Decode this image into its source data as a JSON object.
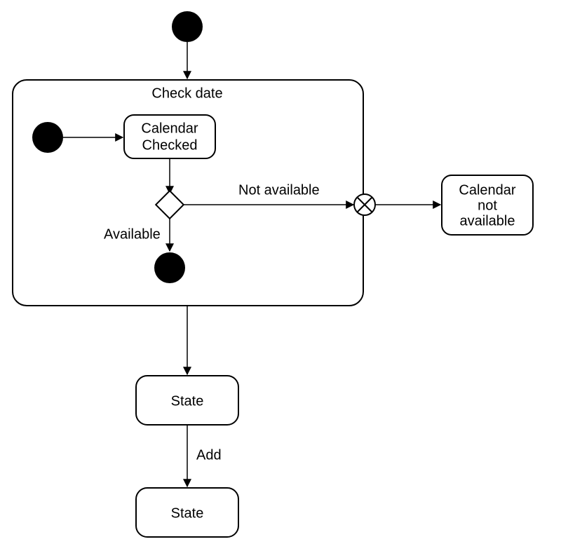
{
  "container": {
    "title": "Check date"
  },
  "nodes": {
    "calendar_checked": {
      "line1": "Calendar",
      "line2": "Checked"
    },
    "state1": {
      "label": "State"
    },
    "state2": {
      "label": "State"
    },
    "calendar_not_available": {
      "line1": "Calendar",
      "line2": "not",
      "line3": "available"
    }
  },
  "edges": {
    "not_available": "Not available",
    "available": "Available",
    "add": "Add"
  }
}
